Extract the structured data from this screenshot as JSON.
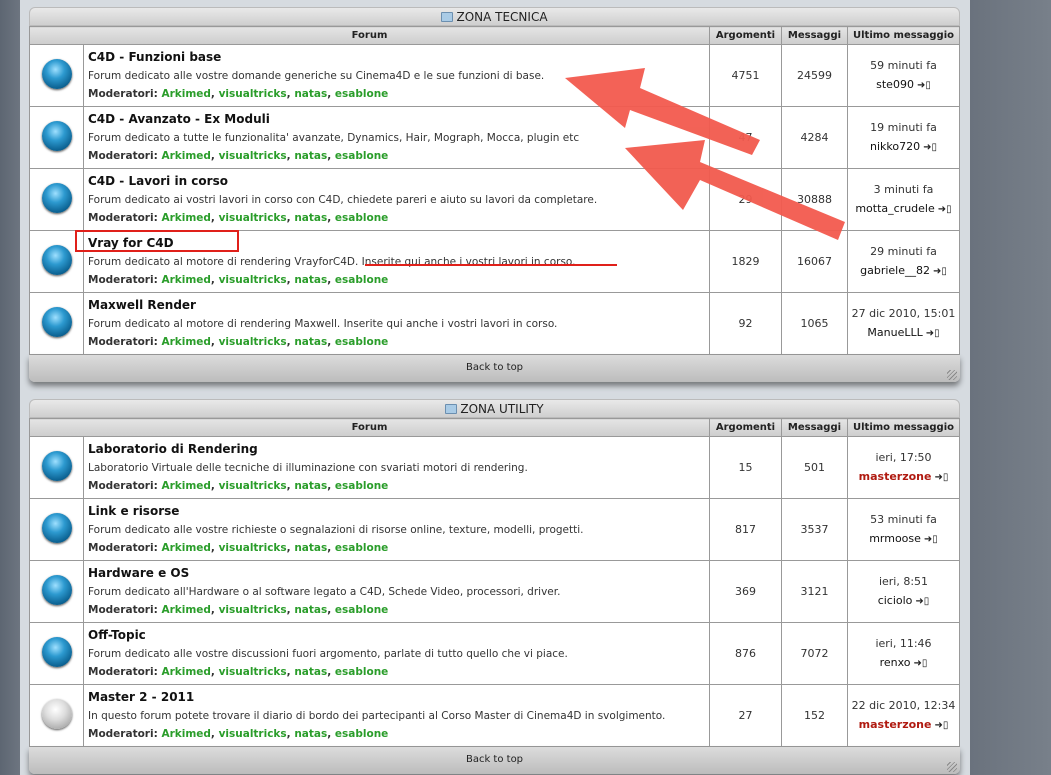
{
  "columns": {
    "forum": "Forum",
    "topics": "Argomenti",
    "posts": "Messaggi",
    "last": "Ultimo messaggio"
  },
  "mod_label": "Moderatori:",
  "moderators": [
    "Arkimed",
    "visualtricks",
    "natas",
    "esablone"
  ],
  "back_to_top": "Back to top",
  "goto_icon": "go-to-last-post-icon",
  "sections": [
    {
      "title": "ZONA TECNICA",
      "forums": [
        {
          "title": "C4D - Funzioni base",
          "desc": "Forum dedicato alle vostre domande generiche su Cinema4D e le sue funzioni di base.",
          "topics": "4751",
          "posts": "24599",
          "last_time": "59 minuti fa",
          "last_user": "ste090"
        },
        {
          "title": "C4D - Avanzato - Ex Moduli",
          "desc": "Forum dedicato a tutte le funzionalita' avanzate, Dynamics, Hair, Mograph, Mocca, plugin etc",
          "topics": "47",
          "posts": "4284",
          "last_time": "19 minuti fa",
          "last_user": "nikko720"
        },
        {
          "title": "C4D - Lavori in corso",
          "desc": "Forum dedicato ai vostri lavori in corso con C4D, chiedete pareri e aiuto su lavori da completare.",
          "topics": "29",
          "posts": "30888",
          "last_time": "3 minuti fa",
          "last_user": "motta_crudele"
        },
        {
          "title": "Vray for C4D",
          "desc": "Forum dedicato al motore di rendering VrayforC4D. Inserite qui anche i vostri lavori in corso.",
          "topics": "1829",
          "posts": "16067",
          "last_time": "29 minuti fa",
          "last_user": "gabriele__82"
        },
        {
          "title": "Maxwell Render",
          "desc": "Forum dedicato al motore di rendering Maxwell. Inserite qui anche i vostri lavori in corso.",
          "topics": "92",
          "posts": "1065",
          "last_time": "27 dic 2010, 15:01",
          "last_user": "ManueLLL"
        }
      ]
    },
    {
      "title": "ZONA UTILITY",
      "forums": [
        {
          "title": "Laboratorio di Rendering",
          "desc": "Laboratorio Virtuale delle tecniche di illuminazione con svariati motori di rendering.",
          "topics": "15",
          "posts": "501",
          "last_time": "ieri, 17:50",
          "last_user": "masterzone",
          "red": true
        },
        {
          "title": "Link e risorse",
          "desc": "Forum dedicato alle vostre richieste o segnalazioni di risorse online, texture, modelli, progetti.",
          "topics": "817",
          "posts": "3537",
          "last_time": "53 minuti fa",
          "last_user": "mrmoose"
        },
        {
          "title": "Hardware e OS",
          "desc": "Forum dedicato all'Hardware o al software legato a C4D, Schede Video, processori, driver.",
          "topics": "369",
          "posts": "3121",
          "last_time": "ieri, 8:51",
          "last_user": "ciciolo"
        },
        {
          "title": "Off-Topic",
          "desc": "Forum dedicato alle vostre discussioni fuori argomento, parlate di tutto quello che vi piace.",
          "topics": "876",
          "posts": "7072",
          "last_time": "ieri, 11:46",
          "last_user": "renxo"
        },
        {
          "title": "Master 2 - 2011",
          "desc": "In questo forum potete trovare il diario di bordo dei partecipanti al Corso Master di Cinema4D in svolgimento.",
          "topics": "27",
          "posts": "152",
          "last_time": "22 dic 2010, 12:34",
          "last_user": "masterzone",
          "red": true,
          "grey": true
        }
      ]
    }
  ],
  "annotation_color": "#f25a4e"
}
